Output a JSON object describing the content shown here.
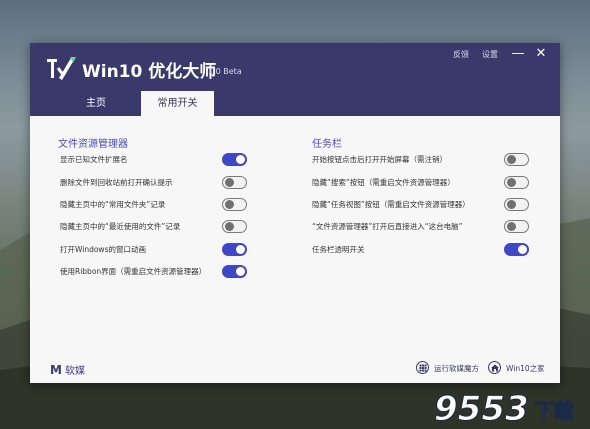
{
  "window": {
    "title": "Win10 优化大师",
    "version": "1.0 Beta",
    "feedback": "反馈",
    "settings": "设置",
    "minimize": "—",
    "close": "✕"
  },
  "tabs": [
    {
      "label": "主页",
      "active": false
    },
    {
      "label": "常用开关",
      "active": true
    }
  ],
  "left": {
    "title": "文件资源管理器",
    "items": [
      {
        "label": "显示已知文件扩展名",
        "on": true
      },
      {
        "label": "删除文件到回收站前打开确认提示",
        "on": false
      },
      {
        "label": "隐藏主页中的“常用文件夹”记录",
        "on": false
      },
      {
        "label": "隐藏主页中的“最近使用的文件”记录",
        "on": false
      },
      {
        "label": "打开Windows的窗口动画",
        "on": true
      },
      {
        "label": "使用Ribbon界面（需重启文件资源管理器）",
        "on": true
      }
    ]
  },
  "right": {
    "title": "任务栏",
    "items": [
      {
        "label": "开始按钮点击后打开开始屏幕（需注销）",
        "on": false
      },
      {
        "label": "隐藏“搜索”按钮（需重启文件资源管理器）",
        "on": false
      },
      {
        "label": "隐藏“任务视图”按钮（需重启文件资源管理器）",
        "on": false
      },
      {
        "label": "“文件资源管理器”打开后直接进入“这台电脑”",
        "on": false
      },
      {
        "label": "任务栏透明开关",
        "on": true
      }
    ]
  },
  "footer": {
    "brand_letter": "M",
    "brand": "软媒",
    "cube_button": "运行软媒魔方",
    "home_button": "Win10之家"
  },
  "watermark": {
    "number": "9553",
    "text": "下载"
  },
  "colors": {
    "accent": "#3f47c8",
    "header": "#393a6b",
    "section_title": "#4a4ac6"
  },
  "icons": {
    "logo": "tools-logo-icon",
    "grid": "grid-icon",
    "home": "home-icon"
  }
}
